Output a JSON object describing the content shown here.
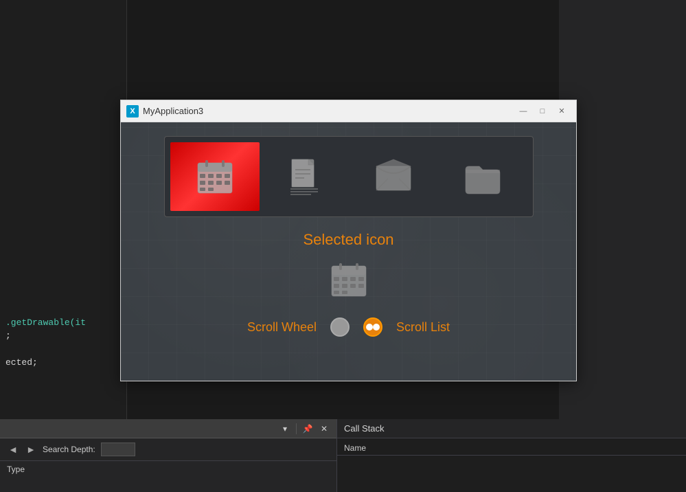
{
  "app": {
    "title": "MyApplication3",
    "icon_letter": "X",
    "window_controls": {
      "minimize": "—",
      "maximize": "□",
      "close": "✕"
    }
  },
  "icons": [
    {
      "id": "calendar",
      "label": "Calendar",
      "selected": true
    },
    {
      "id": "document",
      "label": "Document",
      "selected": false
    },
    {
      "id": "envelope",
      "label": "Envelope",
      "selected": false
    },
    {
      "id": "folder",
      "label": "Folder",
      "selected": false
    }
  ],
  "selected_section": {
    "label": "Selected icon",
    "icon": "calendar"
  },
  "radio_options": [
    {
      "id": "scroll_wheel",
      "label": "Scroll Wheel",
      "active": false
    },
    {
      "id": "scroll_list",
      "label": "Scroll List",
      "active": true
    }
  ],
  "code_lines": [
    {
      "text": ".getDrawable(it",
      "type": "method"
    },
    {
      "text": ";",
      "type": "normal"
    },
    {
      "text": "ected;",
      "type": "normal"
    }
  ],
  "bottom_panel": {
    "call_stack": {
      "title": "Call Stack",
      "columns": [
        "Name"
      ]
    },
    "search": {
      "depth_label": "Search Depth:",
      "type_label": "Type"
    }
  },
  "toolbar": {
    "dropdown_icon": "▾",
    "pin_icon": "📌",
    "close_icon": "✕"
  }
}
